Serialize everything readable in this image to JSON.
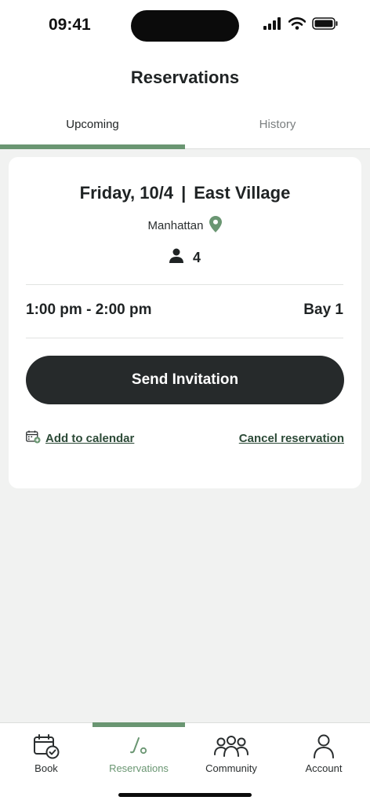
{
  "status_bar": {
    "time": "09:41"
  },
  "header": {
    "title": "Reservations"
  },
  "tabs": [
    {
      "label": "Upcoming",
      "active": true
    },
    {
      "label": "History",
      "active": false
    }
  ],
  "reservation": {
    "date": "Friday, 10/4",
    "separator": "|",
    "venue": "East Village",
    "borough": "Manhattan",
    "guests": "4",
    "time_range": "1:00 pm - 2:00 pm",
    "bay": "Bay 1",
    "invite_label": "Send Invitation",
    "add_calendar_label": "Add to calendar",
    "cancel_label": "Cancel reservation"
  },
  "bottom_nav": [
    {
      "label": "Book",
      "icon": "calendar-check-icon",
      "active": false
    },
    {
      "label": "Reservations",
      "icon": "golf-club-icon",
      "active": true
    },
    {
      "label": "Community",
      "icon": "people-group-icon",
      "active": false
    },
    {
      "label": "Account",
      "icon": "person-icon",
      "active": false
    }
  ],
  "colors": {
    "accent": "#6a9672",
    "link": "#2c4a37",
    "button": "#262a2b",
    "background": "#f1f2f1"
  }
}
